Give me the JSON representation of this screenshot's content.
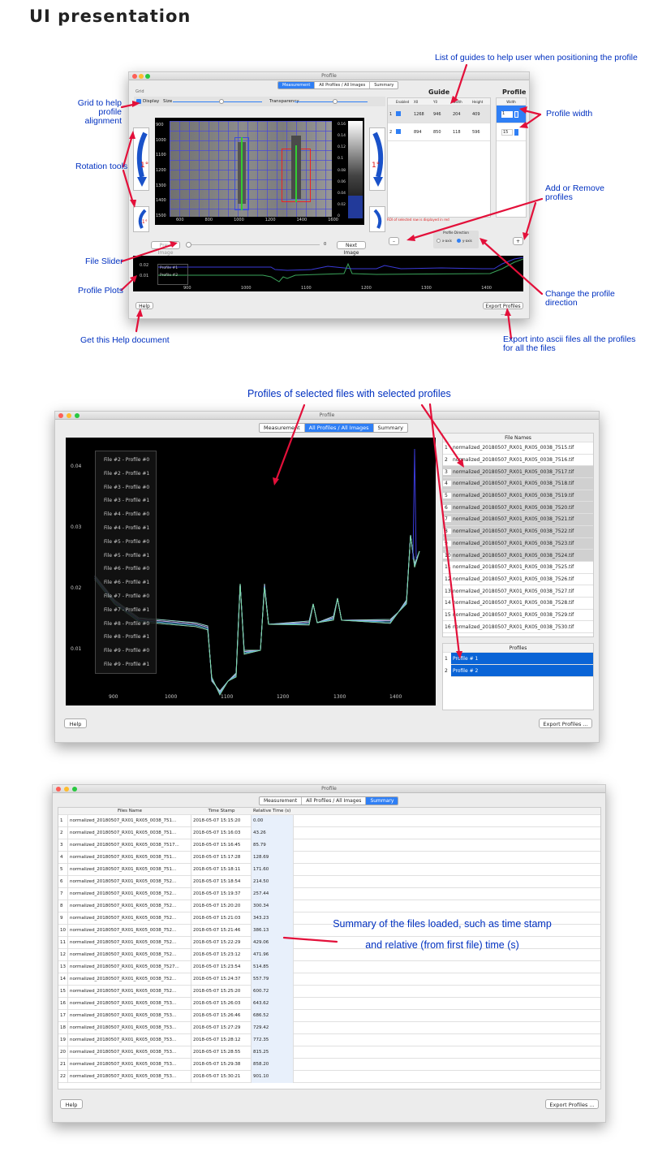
{
  "page": {
    "title": "UI presentation"
  },
  "win1": {
    "title": "Profile",
    "tabs": [
      "Measurement",
      "All Profiles / All Images",
      "Summary"
    ],
    "grid_label": "Grid",
    "display_label": "Display",
    "size_label": "Size",
    "transparency_label": "Transparency",
    "rot_label": "1°",
    "guide_title": "Guide",
    "profile_title": "Profile",
    "guide_headers": [
      "Enabled",
      "X0",
      "Y0",
      "Width",
      "Height"
    ],
    "guide_rows": [
      [
        "1",
        "1268",
        "946",
        "204",
        "409"
      ],
      [
        "2",
        "894",
        "850",
        "118",
        "596"
      ]
    ],
    "width_header": "Width",
    "width_values": [
      "1",
      "15"
    ],
    "roi_note": "ROI of selected row is displayed in red",
    "profile_direction_label": "Profile Direction",
    "x_axis": "x-axis",
    "y_axis": "y-axis",
    "minus": "–",
    "plus": "+",
    "prev_label": "Prev. Image",
    "next_label": "Next Image",
    "slider_value": "0",
    "img_y_ticks": [
      "900",
      "1000",
      "1100",
      "1200",
      "1300",
      "1400",
      "1500"
    ],
    "img_x_ticks": [
      "600",
      "800",
      "1000",
      "1200",
      "1400",
      "1600"
    ],
    "cbar_ticks": [
      "0.16",
      "0.14",
      "0.12",
      "0.1",
      "0.08",
      "0.06",
      "0.04",
      "0.02",
      "0"
    ],
    "profile_labels": [
      "Profile #1",
      "Profile #2"
    ],
    "plot_y_ticks": [
      "0.02",
      "0.01"
    ],
    "plot_x_ticks": [
      "900",
      "1000",
      "1100",
      "1200",
      "1300",
      "1400"
    ],
    "help_label": "Help",
    "export_label": "Export Profiles ..."
  },
  "annotations": {
    "guides": "List of guides to help user when positioning the profile",
    "grid": "Grid to help profile\nalignment",
    "rotation": "Rotation tools",
    "slider": "File Slider",
    "plots": "Profile Plots",
    "help": "Get this Help document",
    "profile_width": "Profile width",
    "add_remove": "Add or Remove\nprofiles",
    "direction": "Change the profile\ndirection",
    "export": "Export into ascii files all the profiles\nfor all the files",
    "profiles_selected": "Profiles of selected files with selected profiles",
    "summary": "Summary of the files loaded, such as time stamp\nand relative (from first file) time (s)"
  },
  "win2": {
    "title": "Profile",
    "tabs": [
      "Measurement",
      "All Profiles / All Images",
      "Summary"
    ],
    "legend": [
      "File #2 - Profile #0",
      "File #2 - Profile #1",
      "File #3 - Profile #0",
      "File #3 - Profile #1",
      "File #4 - Profile #0",
      "File #4 - Profile #1",
      "File #5 - Profile #0",
      "File #5 - Profile #1",
      "File #6 - Profile #0",
      "File #6 - Profile #1",
      "File #7 - Profile #0",
      "File #7 - Profile #1",
      "File #8 - Profile #0",
      "File #8 - Profile #1",
      "File #9 - Profile #0",
      "File #9 - Profile #1"
    ],
    "y_ticks": [
      "0.04",
      "0.03",
      "0.02",
      "0.01"
    ],
    "x_ticks": [
      "900",
      "1000",
      "1100",
      "1200",
      "1300",
      "1400"
    ],
    "file_names_header": "File Names",
    "files": [
      "normalized_20180507_RX01_RX05_0038_7515.tif",
      "normalized_20180507_RX01_RX05_0038_7516.tif",
      "normalized_20180507_RX01_RX05_0038_7517.tif",
      "normalized_20180507_RX01_RX05_0038_7518.tif",
      "normalized_20180507_RX01_RX05_0038_7519.tif",
      "normalized_20180507_RX01_RX05_0038_7520.tif",
      "normalized_20180507_RX01_RX05_0038_7521.tif",
      "normalized_20180507_RX01_RX05_0038_7522.tif",
      "normalized_20180507_RX01_RX05_0038_7523.tif",
      "normalized_20180507_RX01_RX05_0038_7524.tif",
      "normalized_20180507_RX01_RX05_0038_7525.tif",
      "normalized_20180507_RX01_RX05_0038_7526.tif",
      "normalized_20180507_RX01_RX05_0038_7527.tif",
      "normalized_20180507_RX01_RX05_0038_7528.tif",
      "normalized_20180507_RX01_RX05_0038_7529.tif",
      "normalized_20180507_RX01_RX05_0038_7530.tif"
    ],
    "file_row_numbers": [
      "1",
      "2",
      "3",
      "4",
      "5",
      "6",
      "7",
      "8",
      "9",
      "10",
      "11",
      "12",
      "13",
      "14",
      "15",
      "16"
    ],
    "profiles_header": "Profiles",
    "profiles": [
      "Profile # 1",
      "Profile # 2"
    ],
    "profile_row_numbers": [
      "1",
      "2"
    ],
    "help_label": "Help",
    "export_label": "Export Profiles ..."
  },
  "win3": {
    "title": "Profile",
    "tabs": [
      "Measurement",
      "All Profiles / All Images",
      "Summary"
    ],
    "headers": [
      "Files Name",
      "Time Stamp",
      "Relative Time (s)"
    ],
    "rows": [
      [
        "1",
        "normalized_20180507_RX01_RX05_0038_751...",
        "2018-05-07 15:15:20",
        "0.00"
      ],
      [
        "2",
        "normalized_20180507_RX01_RX05_0038_751...",
        "2018-05-07 15:16:03",
        "43.26"
      ],
      [
        "3",
        "normalized_20180507_RX01_RX05_0038_7517...",
        "2018-05-07 15:16:45",
        "85.79"
      ],
      [
        "4",
        "normalized_20180507_RX01_RX05_0038_751...",
        "2018-05-07 15:17:28",
        "128.69"
      ],
      [
        "5",
        "normalized_20180507_RX01_RX05_0038_751...",
        "2018-05-07 15:18:11",
        "171.60"
      ],
      [
        "6",
        "normalized_20180507_RX01_RX05_0038_752...",
        "2018-05-07 15:18:54",
        "214.50"
      ],
      [
        "7",
        "normalized_20180507_RX01_RX05_0038_752...",
        "2018-05-07 15:19:37",
        "257.44"
      ],
      [
        "8",
        "normalized_20180507_RX01_RX05_0038_752...",
        "2018-05-07 15:20:20",
        "300.34"
      ],
      [
        "9",
        "normalized_20180507_RX01_RX05_0038_752...",
        "2018-05-07 15:21:03",
        "343.23"
      ],
      [
        "10",
        "normalized_20180507_RX01_RX05_0038_752...",
        "2018-05-07 15:21:46",
        "386.13"
      ],
      [
        "11",
        "normalized_20180507_RX01_RX05_0038_752...",
        "2018-05-07 15:22:29",
        "429.06"
      ],
      [
        "12",
        "normalized_20180507_RX01_RX05_0038_752...",
        "2018-05-07 15:23:12",
        "471.96"
      ],
      [
        "13",
        "normalized_20180507_RX01_RX05_0038_7527...",
        "2018-05-07 15:23:54",
        "514.85"
      ],
      [
        "14",
        "normalized_20180507_RX01_RX05_0038_752...",
        "2018-05-07 15:24:37",
        "557.79"
      ],
      [
        "15",
        "normalized_20180507_RX01_RX05_0038_752...",
        "2018-05-07 15:25:20",
        "600.72"
      ],
      [
        "16",
        "normalized_20180507_RX01_RX05_0038_753...",
        "2018-05-07 15:26:03",
        "643.62"
      ],
      [
        "17",
        "normalized_20180507_RX01_RX05_0038_753...",
        "2018-05-07 15:26:46",
        "686.52"
      ],
      [
        "18",
        "normalized_20180507_RX01_RX05_0038_753...",
        "2018-05-07 15:27:29",
        "729.42"
      ],
      [
        "19",
        "normalized_20180507_RX01_RX05_0038_753...",
        "2018-05-07 15:28:12",
        "772.35"
      ],
      [
        "20",
        "normalized_20180507_RX01_RX05_0038_753...",
        "2018-05-07 15:28:55",
        "815.25"
      ],
      [
        "21",
        "normalized_20180507_RX01_RX05_0038_753...",
        "2018-05-07 15:29:38",
        "858.20"
      ],
      [
        "22",
        "normalized_20180507_RX01_RX05_0038_753...",
        "2018-05-07 15:30:21",
        "901.10"
      ]
    ],
    "help_label": "Help",
    "export_label": "Export Profiles ..."
  }
}
